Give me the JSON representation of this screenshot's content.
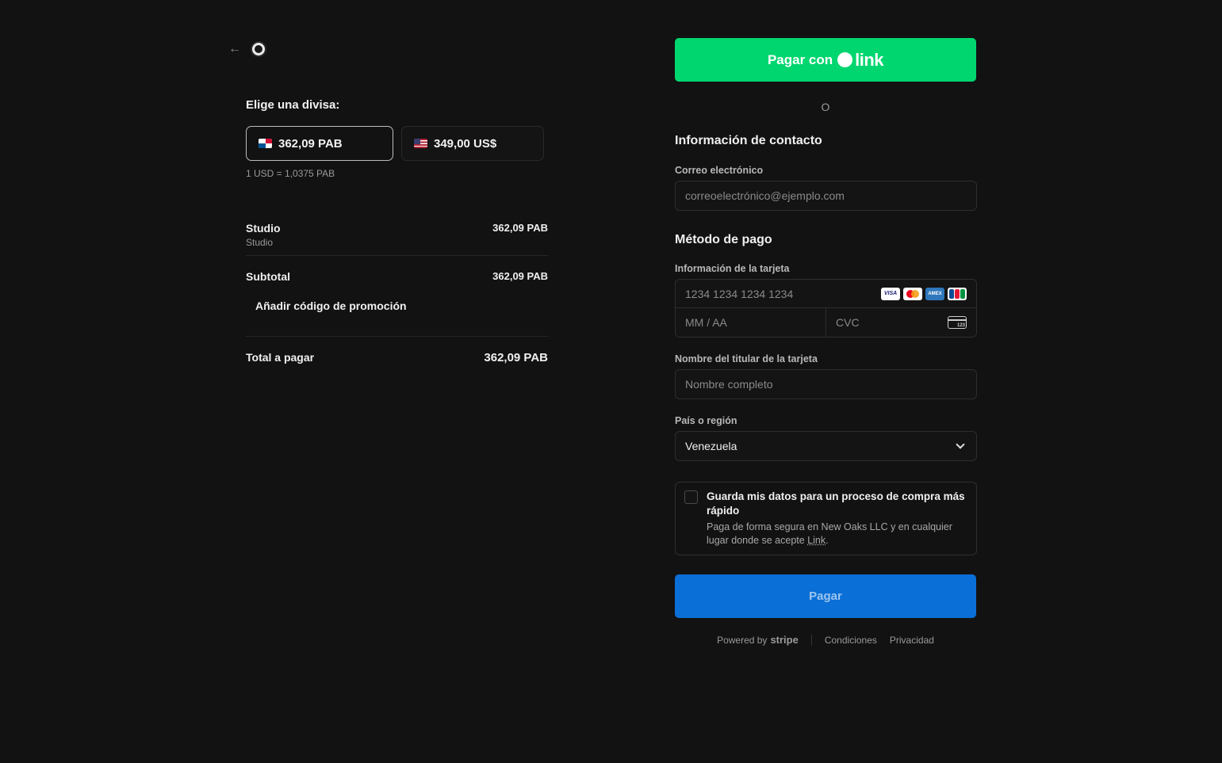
{
  "summary": {
    "currency_title": "Elige una divisa:",
    "currencies": [
      {
        "amount": "362,09 PAB",
        "flag": "panama-flag"
      },
      {
        "amount": "349,00 US$",
        "flag": "us-flag"
      }
    ],
    "rate": "1 USD = 1,0375 PAB",
    "item": {
      "name": "Studio",
      "description": "Studio",
      "amount": "362,09 PAB"
    },
    "subtotal": {
      "label": "Subtotal",
      "amount": "362,09 PAB"
    },
    "promo_label": "Añadir código de promoción",
    "total": {
      "label": "Total a pagar",
      "amount": "362,09 PAB"
    }
  },
  "checkout": {
    "link_button": {
      "prefix": "Pagar con",
      "brand": "link"
    },
    "or_label": "O",
    "contact": {
      "title": "Información de contacto",
      "email_label": "Correo electrónico",
      "email_placeholder": "correoelectrónico@ejemplo.com"
    },
    "payment": {
      "title": "Método de pago",
      "card_label": "Información de la tarjeta",
      "card_placeholder": "1234 1234 1234 1234",
      "expiry_placeholder": "MM / AA",
      "cvc_placeholder": "CVC",
      "cvc_icon_text": "123",
      "brands": [
        "VISA",
        "mastercard",
        "AMEX",
        "JCB"
      ],
      "holder_label": "Nombre del titular de la tarjeta",
      "holder_placeholder": "Nombre completo",
      "country_label": "País o región",
      "country_value": "Venezuela"
    },
    "save": {
      "title": "Guarda mis datos para un proceso de compra más rápido",
      "desc_prefix": "Paga de forma segura en New Oaks LLC y en cualquier lugar donde se acepte ",
      "desc_link": "Link",
      "desc_suffix": "."
    },
    "pay_button": "Pagar",
    "footer": {
      "powered_by": "Powered by",
      "stripe": "stripe",
      "terms": "Condiciones",
      "privacy": "Privacidad"
    }
  },
  "colors": {
    "background": "#121212",
    "link_green": "#00d66f",
    "pay_blue": "#0a6fd6"
  }
}
